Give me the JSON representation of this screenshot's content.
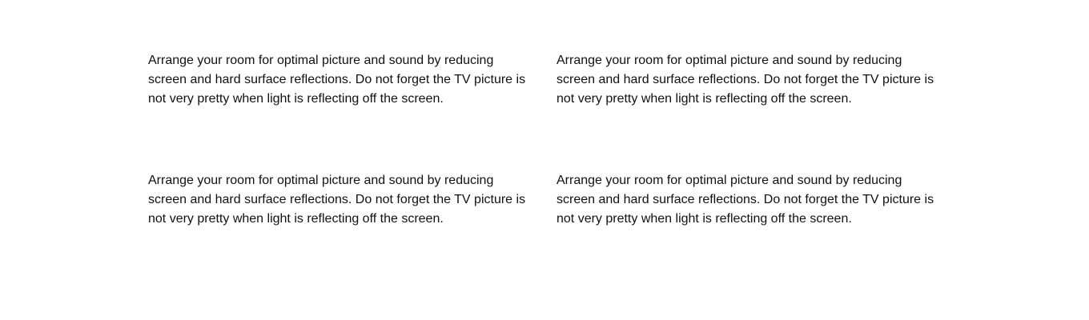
{
  "tips": [
    {
      "text": "Arrange your room for optimal picture and sound by reducing screen and hard surface reflections. Do not forget the TV picture is not very pretty when light is reflecting off the screen."
    },
    {
      "text": "Arrange your room for optimal picture and sound by reducing screen and hard surface reflections. Do not forget the TV picture is not very pretty when light is reflecting off the screen."
    },
    {
      "text": "Arrange your room for optimal picture and sound by reducing screen and hard surface reflections. Do not forget the TV picture is not very pretty when light is reflecting off the screen."
    },
    {
      "text": "Arrange your room for optimal picture and sound by reducing screen and hard surface reflections. Do not forget the TV picture is not very pretty when light is reflecting off the screen."
    }
  ]
}
